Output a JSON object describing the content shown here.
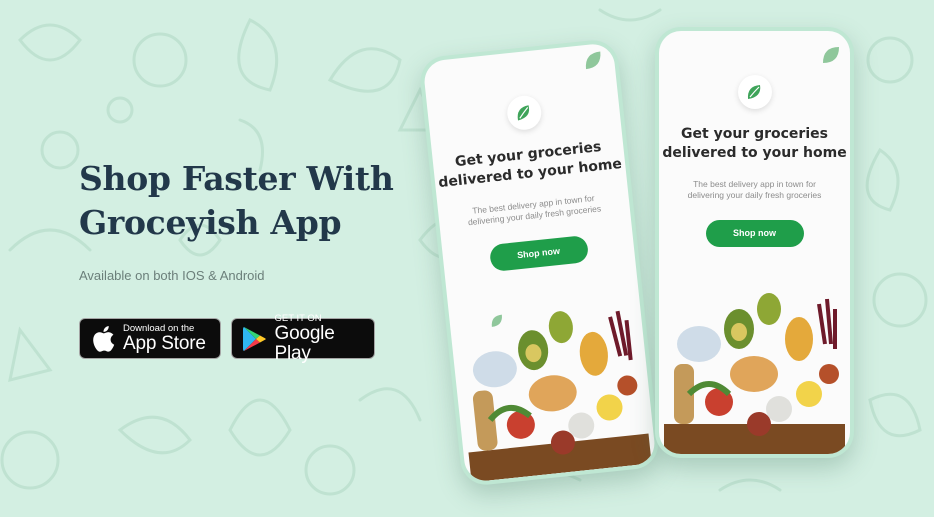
{
  "hero": {
    "title": "Shop Faster With\nGroceyish App",
    "subtitle": "Available on both IOS & Android"
  },
  "stores": {
    "apple": {
      "small": "Download on the",
      "big": "App Store",
      "icon": "apple-icon"
    },
    "google": {
      "small": "GET IT ON",
      "big": "Google Play",
      "icon": "google-play-icon"
    }
  },
  "app_screen": {
    "title": "Get your groceries\ndelivered to your home",
    "description": "The best delivery app in town for\ndelivering your daily fresh groceries",
    "cta": "Shop now",
    "logo_icon": "leaf-icon"
  },
  "colors": {
    "background": "#d3efe2",
    "heading": "#22384a",
    "accent": "#1f9e4a",
    "store_button": "#0c0c0c"
  }
}
